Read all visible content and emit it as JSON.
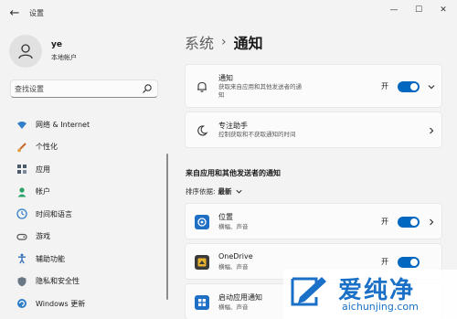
{
  "window": {
    "title": "设置",
    "back_glyph": "←",
    "min_glyph": "—",
    "max_glyph": "☐",
    "close_glyph": "✕"
  },
  "profile": {
    "name": "ye",
    "account_type": "本地帐户"
  },
  "search": {
    "placeholder": "查找设置",
    "icon": "search-icon"
  },
  "sidebar": {
    "items": [
      {
        "label": "网络 & Internet",
        "icon": "wifi-icon"
      },
      {
        "label": "个性化",
        "icon": "brush-icon"
      },
      {
        "label": "应用",
        "icon": "apps-icon"
      },
      {
        "label": "帐户",
        "icon": "person-icon"
      },
      {
        "label": "时间和语言",
        "icon": "globe-clock-icon"
      },
      {
        "label": "游戏",
        "icon": "gamepad-icon"
      },
      {
        "label": "辅助功能",
        "icon": "accessibility-icon"
      },
      {
        "label": "隐私和安全性",
        "icon": "shield-icon"
      },
      {
        "label": "Windows 更新",
        "icon": "update-icon"
      }
    ]
  },
  "main": {
    "breadcrumb_parent": "系统",
    "breadcrumb_sep": "›",
    "breadcrumb_current": "通知",
    "notifications_card": {
      "title": "通知",
      "subtitle_line1": "获取来自应用和其他发送者的通",
      "subtitle_line2": "知",
      "toggle_label": "开",
      "toggle_on": true
    },
    "focus_card": {
      "title": "专注助手",
      "subtitle": "控制获取和不获取通知的时间"
    },
    "section_title": "来自应用和其他发送者的通知",
    "sort_label": "排序依据:",
    "sort_value": "最新",
    "apps": [
      {
        "name": "位置",
        "subtitle": "横幅、声音",
        "toggle_label": "开",
        "toggle_on": true
      },
      {
        "name": "OneDrive",
        "subtitle": "横幅、声音",
        "toggle_label": "开",
        "toggle_on": true
      },
      {
        "name": "启动应用通知",
        "subtitle": "横幅、声音"
      }
    ]
  },
  "watermark": {
    "text_cn": "爱纯净",
    "text_en": "aichunjing.com"
  },
  "colors": {
    "accent": "#0067c0",
    "background": "#f3f3f3",
    "card": "#fbfbfb"
  }
}
